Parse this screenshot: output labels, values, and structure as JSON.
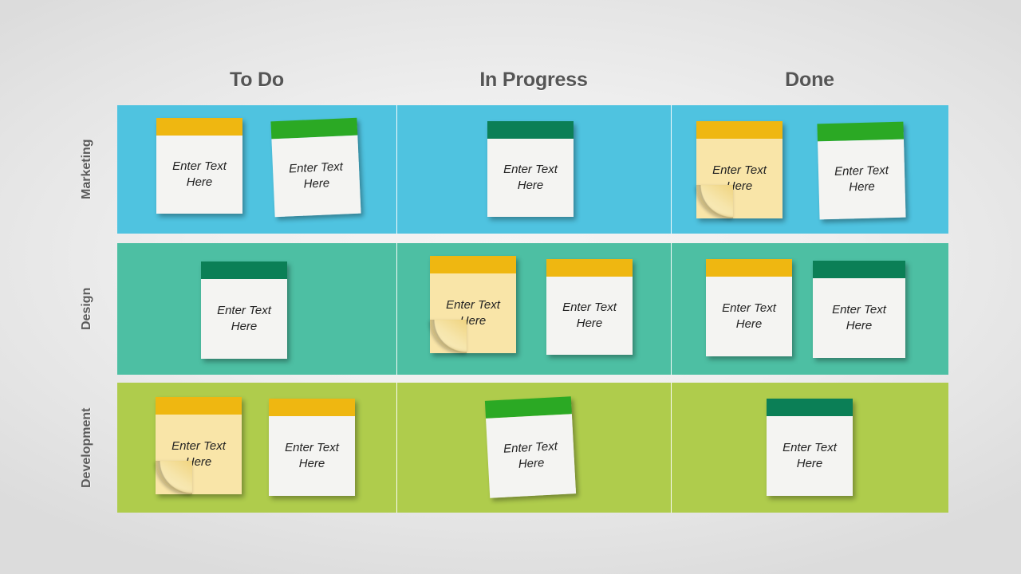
{
  "board": {
    "title": "Kanban Board",
    "columns": [
      {
        "label": "To Do"
      },
      {
        "label": "In Progress"
      },
      {
        "label": "Done"
      }
    ],
    "rows": [
      {
        "label": "Marketing",
        "color": "#4FC3E0"
      },
      {
        "label": "Design",
        "color": "#4DBFA3"
      },
      {
        "label": "Development",
        "color": "#AFCC4C"
      }
    ],
    "note_colors": {
      "gold": "#EFB711",
      "green": "#2BA924",
      "dark_teal": "#0B7F56",
      "paper_white": "#F4F4F2",
      "paper_yellow": "#F9E5A8"
    },
    "note_text": "Enter Text Here",
    "note_text_line1": "Enter Text",
    "note_text_line2": "Here",
    "cells": [
      {
        "row": "Marketing",
        "column": "To Do",
        "notes": [
          {
            "header": "gold",
            "paper": "white",
            "rotation": 0,
            "curled": false
          },
          {
            "header": "green",
            "paper": "white",
            "rotation": -2.5,
            "curled": false
          }
        ]
      },
      {
        "row": "Marketing",
        "column": "In Progress",
        "notes": [
          {
            "header": "dark_teal",
            "paper": "white",
            "rotation": 0,
            "curled": false
          }
        ]
      },
      {
        "row": "Marketing",
        "column": "Done",
        "notes": [
          {
            "header": "gold",
            "paper": "yellow",
            "rotation": 0,
            "curled": true
          },
          {
            "header": "green",
            "paper": "white",
            "rotation": -1.5,
            "curled": false
          }
        ]
      },
      {
        "row": "Design",
        "column": "To Do",
        "notes": [
          {
            "header": "dark_teal",
            "paper": "white",
            "rotation": 0,
            "curled": false
          }
        ]
      },
      {
        "row": "Design",
        "column": "In Progress",
        "notes": [
          {
            "header": "gold",
            "paper": "yellow",
            "rotation": 0,
            "curled": true
          },
          {
            "header": "gold",
            "paper": "white",
            "rotation": 0,
            "curled": false
          }
        ]
      },
      {
        "row": "Design",
        "column": "Done",
        "notes": [
          {
            "header": "gold",
            "paper": "white",
            "rotation": 0,
            "curled": false
          },
          {
            "header": "dark_teal",
            "paper": "white",
            "rotation": 0,
            "curled": false
          }
        ]
      },
      {
        "row": "Development",
        "column": "To Do",
        "notes": [
          {
            "header": "gold",
            "paper": "yellow",
            "rotation": 0,
            "curled": true
          },
          {
            "header": "gold",
            "paper": "white",
            "rotation": 0,
            "curled": false
          }
        ]
      },
      {
        "row": "Development",
        "column": "In Progress",
        "notes": [
          {
            "header": "green",
            "paper": "white",
            "rotation": -3,
            "curled": false
          }
        ]
      },
      {
        "row": "Development",
        "column": "Done",
        "notes": [
          {
            "header": "dark_teal",
            "paper": "white",
            "rotation": 0,
            "curled": false
          }
        ]
      }
    ]
  }
}
